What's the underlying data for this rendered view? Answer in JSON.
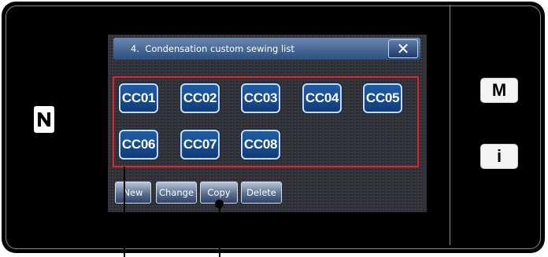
{
  "dialog": {
    "title": "4.  Condensation custom sewing list",
    "close_symbol": "✕"
  },
  "custom_patterns": [
    "CC01",
    "CC02",
    "CC03",
    "CC04",
    "CC05",
    "CC06",
    "CC07",
    "CC08"
  ],
  "actions": {
    "new_label": "New",
    "change_label": "Change",
    "copy_label": "Copy",
    "delete_label": "Delete"
  },
  "side_buttons": {
    "mode_label": "M",
    "info_label": "i"
  },
  "icons": {
    "nfc": "nfc-icon",
    "close": "close-icon"
  },
  "colors": {
    "screen_background": "#2e3035",
    "pattern_button": "#1a4f90",
    "highlight_frame": "#e0242a",
    "titlebar": "#3d5f8f"
  }
}
